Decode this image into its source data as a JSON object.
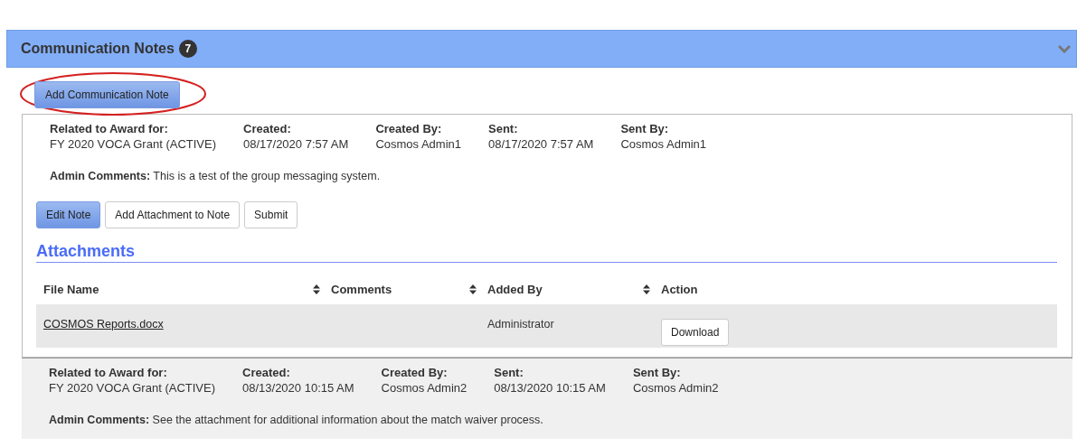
{
  "section": {
    "title": "Communication Notes",
    "count": "7",
    "expanded": true
  },
  "add_button": {
    "label": "Add Communication Note",
    "circled": true
  },
  "notes": [
    {
      "highlighted": false,
      "fields": [
        {
          "label": "Related to Award for:",
          "value": "FY 2020 VOCA Grant (ACTIVE)"
        },
        {
          "label": "Created:",
          "value": "08/17/2020 7:57 AM"
        },
        {
          "label": "Created By:",
          "value": "Cosmos Admin1"
        },
        {
          "label": "Sent:",
          "value": "08/17/2020 7:57 AM"
        },
        {
          "label": "Sent By:",
          "value": "Cosmos Admin1"
        }
      ],
      "comments": "**Admin Comments:** This is a test of the group messaging system.",
      "buttons": [
        {
          "label": "Edit Note",
          "primary": true
        },
        {
          "label": "Add Attachment to Note",
          "primary": false
        },
        {
          "label": "Submit",
          "primary": false
        }
      ],
      "attachments": {
        "title": "Attachments",
        "columns": [
          {
            "label": "File Name",
            "sortable": true
          },
          {
            "label": "Comments",
            "sortable": true
          },
          {
            "label": "Added By",
            "sortable": true
          },
          {
            "label": "Action",
            "sortable": false
          }
        ],
        "rows": [
          {
            "file_name": "COSMOS Reports.docx",
            "added_by": "Administrator",
            "action": "Download"
          }
        ]
      }
    },
    {
      "highlighted": true,
      "fields": [
        {
          "label": "Related to Award for:",
          "value": "FY 2020 VOCA Grant (ACTIVE)"
        },
        {
          "label": "Created:",
          "value": "08/13/2020 10:15 AM"
        },
        {
          "label": "Created By:",
          "value": "Cosmos Admin2"
        },
        {
          "label": "Sent:",
          "value": "08/13/2020 10:15 AM"
        },
        {
          "label": "Sent By:",
          "value": "Cosmos Admin2"
        }
      ],
      "comments": "**Admin Comments:** See the attachment for additional information about the match waiver process."
    }
  ]
}
